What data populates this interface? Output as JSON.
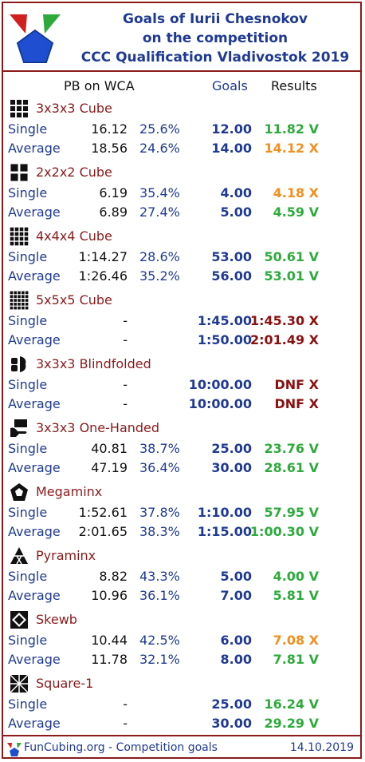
{
  "header": {
    "title_line1": "Goals of Iurii Chesnokov",
    "title_line2": "on the competition",
    "title_line3": "CCC Qualification Vladivostok 2019"
  },
  "columns": {
    "pb": "PB on WCA",
    "goals": "Goals",
    "results": "Results"
  },
  "colors": {
    "success": "#2eaa3c",
    "fail_near": "#f0901e",
    "fail": "#8b1010",
    "primary": "#1f3a93",
    "accent": "#8b1a1a"
  },
  "events": [
    {
      "name": "3x3x3 Cube",
      "icon": "cube3-icon",
      "rows": [
        {
          "label": "Single",
          "pb": "16.12",
          "pct": "25.6%",
          "goal": "12.00",
          "result": "11.82 V",
          "status": "success"
        },
        {
          "label": "Average",
          "pb": "18.56",
          "pct": "24.6%",
          "goal": "14.00",
          "result": "14.12 X",
          "status": "fail_near"
        }
      ]
    },
    {
      "name": "2x2x2 Cube",
      "icon": "cube2-icon",
      "rows": [
        {
          "label": "Single",
          "pb": "6.19",
          "pct": "35.4%",
          "goal": "4.00",
          "result": "4.18 X",
          "status": "fail_near"
        },
        {
          "label": "Average",
          "pb": "6.89",
          "pct": "27.4%",
          "goal": "5.00",
          "result": "4.59 V",
          "status": "success"
        }
      ]
    },
    {
      "name": "4x4x4 Cube",
      "icon": "cube4-icon",
      "rows": [
        {
          "label": "Single",
          "pb": "1:14.27",
          "pct": "28.6%",
          "goal": "53.00",
          "result": "50.61 V",
          "status": "success"
        },
        {
          "label": "Average",
          "pb": "1:26.46",
          "pct": "35.2%",
          "goal": "56.00",
          "result": "53.01 V",
          "status": "success"
        }
      ]
    },
    {
      "name": "5x5x5 Cube",
      "icon": "cube5-icon",
      "rows": [
        {
          "label": "Single",
          "pb": "-",
          "pct": "",
          "goal": "1:45.00",
          "result": "1:45.30 X",
          "status": "fail"
        },
        {
          "label": "Average",
          "pb": "-",
          "pct": "",
          "goal": "1:50.00",
          "result": "2:01.49 X",
          "status": "fail"
        }
      ]
    },
    {
      "name": "3x3x3 Blindfolded",
      "icon": "blindfolded-icon",
      "rows": [
        {
          "label": "Single",
          "pb": "-",
          "pct": "",
          "goal": "10:00.00",
          "result": "DNF X",
          "status": "fail"
        },
        {
          "label": "Average",
          "pb": "-",
          "pct": "",
          "goal": "10:00.00",
          "result": "DNF X",
          "status": "fail"
        }
      ]
    },
    {
      "name": "3x3x3 One-Handed",
      "icon": "one-handed-icon",
      "rows": [
        {
          "label": "Single",
          "pb": "40.81",
          "pct": "38.7%",
          "goal": "25.00",
          "result": "23.76 V",
          "status": "success"
        },
        {
          "label": "Average",
          "pb": "47.19",
          "pct": "36.4%",
          "goal": "30.00",
          "result": "28.61 V",
          "status": "success"
        }
      ]
    },
    {
      "name": "Megaminx",
      "icon": "megaminx-icon",
      "rows": [
        {
          "label": "Single",
          "pb": "1:52.61",
          "pct": "37.8%",
          "goal": "1:10.00",
          "result": "57.95 V",
          "status": "success"
        },
        {
          "label": "Average",
          "pb": "2:01.65",
          "pct": "38.3%",
          "goal": "1:15.00",
          "result": "1:00.30 V",
          "status": "success"
        }
      ]
    },
    {
      "name": "Pyraminx",
      "icon": "pyraminx-icon",
      "rows": [
        {
          "label": "Single",
          "pb": "8.82",
          "pct": "43.3%",
          "goal": "5.00",
          "result": "4.00 V",
          "status": "success"
        },
        {
          "label": "Average",
          "pb": "10.96",
          "pct": "36.1%",
          "goal": "7.00",
          "result": "5.81 V",
          "status": "success"
        }
      ]
    },
    {
      "name": "Skewb",
      "icon": "skewb-icon",
      "rows": [
        {
          "label": "Single",
          "pb": "10.44",
          "pct": "42.5%",
          "goal": "6.00",
          "result": "7.08 X",
          "status": "fail_near"
        },
        {
          "label": "Average",
          "pb": "11.78",
          "pct": "32.1%",
          "goal": "8.00",
          "result": "7.81 V",
          "status": "success"
        }
      ]
    },
    {
      "name": "Square-1",
      "icon": "square1-icon",
      "rows": [
        {
          "label": "Single",
          "pb": "-",
          "pct": "",
          "goal": "25.00",
          "result": "16.24 V",
          "status": "success"
        },
        {
          "label": "Average",
          "pb": "-",
          "pct": "",
          "goal": "30.00",
          "result": "29.29 V",
          "status": "success"
        }
      ]
    }
  ],
  "footer": {
    "left": "FunCubing.org - Competition goals",
    "date": "14.10.2019"
  }
}
